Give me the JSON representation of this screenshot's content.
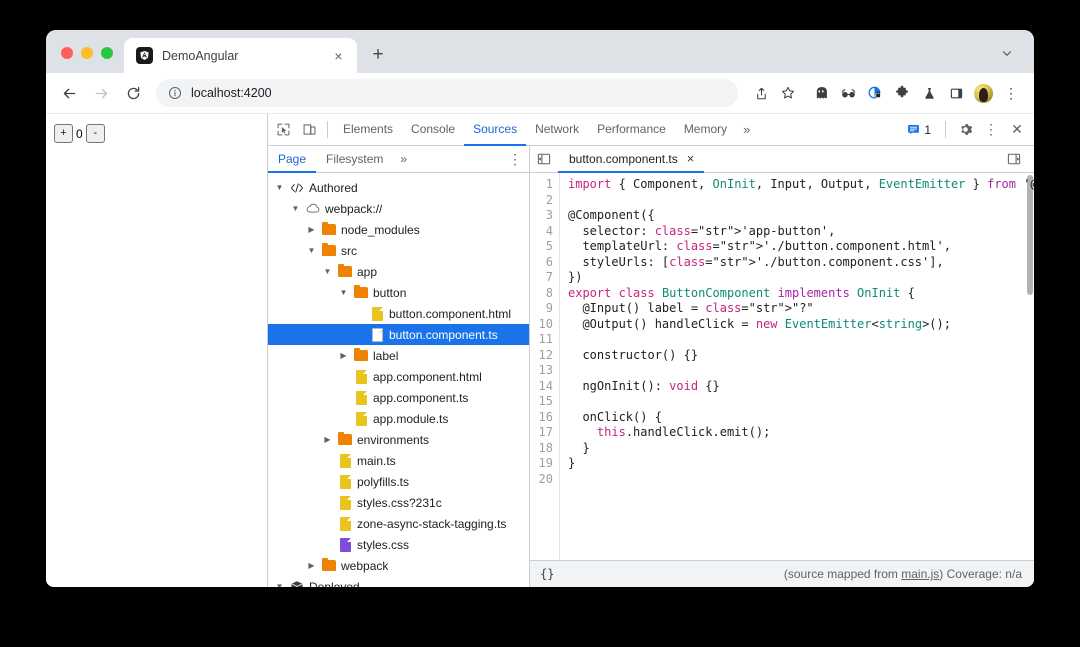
{
  "browser": {
    "tab": {
      "title": "DemoAngular",
      "favicon": "angular-logo",
      "close_label": "×"
    },
    "new_tab_label": "+",
    "nav": {
      "back": "←",
      "forward": "→",
      "reload": "↻"
    },
    "omnibox": {
      "url": "localhost:4200",
      "security_icon": "info-circle-icon"
    },
    "toolbar_icons": [
      "share-icon",
      "bookmark-star-icon",
      "ghost-icon",
      "glasses-icon",
      "privacy-shield-icon",
      "extensions-puzzle-icon",
      "lab-flask-icon",
      "side-panel-icon"
    ],
    "profile": "avatar",
    "menu_label": "⋮"
  },
  "viewport": {
    "zoom_plus": "+",
    "zoom_value": "0",
    "zoom_minus": "-"
  },
  "devtools": {
    "tabs": [
      {
        "label": "Elements",
        "active": false
      },
      {
        "label": "Console",
        "active": false
      },
      {
        "label": "Sources",
        "active": true
      },
      {
        "label": "Network",
        "active": false
      },
      {
        "label": "Performance",
        "active": false
      },
      {
        "label": "Memory",
        "active": false
      }
    ],
    "more_tabs": "»",
    "issues_count": "1",
    "inspect_icon": "inspect-element-icon",
    "device_icon": "device-toolbar-icon",
    "settings_icon": "gear-icon",
    "kebab_icon": "more-options-icon",
    "close_icon": "close-icon",
    "navigator": {
      "tabs": [
        {
          "label": "Page",
          "active": true
        },
        {
          "label": "Filesystem",
          "active": false
        }
      ],
      "more": "»",
      "kebab": "⋮",
      "tree": [
        {
          "indent": 0,
          "twisty": "down",
          "icon": "code-brackets",
          "label": "Authored",
          "selected": false
        },
        {
          "indent": 1,
          "twisty": "down",
          "icon": "cloud",
          "label": "webpack://",
          "selected": false
        },
        {
          "indent": 2,
          "twisty": "right",
          "icon": "folder",
          "label": "node_modules",
          "selected": false
        },
        {
          "indent": 2,
          "twisty": "down",
          "icon": "folder",
          "label": "src",
          "selected": false
        },
        {
          "indent": 3,
          "twisty": "down",
          "icon": "folder",
          "label": "app",
          "selected": false
        },
        {
          "indent": 4,
          "twisty": "down",
          "icon": "folder",
          "label": "button",
          "selected": false
        },
        {
          "indent": 5,
          "twisty": "none",
          "icon": "file-yellow",
          "label": "button.component.html",
          "selected": false
        },
        {
          "indent": 5,
          "twisty": "none",
          "icon": "file-white",
          "label": "button.component.ts",
          "selected": true
        },
        {
          "indent": 4,
          "twisty": "right",
          "icon": "folder",
          "label": "label",
          "selected": false
        },
        {
          "indent": 4,
          "twisty": "none",
          "icon": "file-yellow",
          "label": "app.component.html",
          "selected": false
        },
        {
          "indent": 4,
          "twisty": "none",
          "icon": "file-yellow",
          "label": "app.component.ts",
          "selected": false
        },
        {
          "indent": 4,
          "twisty": "none",
          "icon": "file-yellow",
          "label": "app.module.ts",
          "selected": false
        },
        {
          "indent": 3,
          "twisty": "right",
          "icon": "folder",
          "label": "environments",
          "selected": false
        },
        {
          "indent": 3,
          "twisty": "none",
          "icon": "file-yellow",
          "label": "main.ts",
          "selected": false
        },
        {
          "indent": 3,
          "twisty": "none",
          "icon": "file-yellow",
          "label": "polyfills.ts",
          "selected": false
        },
        {
          "indent": 3,
          "twisty": "none",
          "icon": "file-yellow",
          "label": "styles.css?231c",
          "selected": false
        },
        {
          "indent": 3,
          "twisty": "none",
          "icon": "file-yellow",
          "label": "zone-async-stack-tagging.ts",
          "selected": false
        },
        {
          "indent": 3,
          "twisty": "none",
          "icon": "file-purple",
          "label": "styles.css",
          "selected": false
        },
        {
          "indent": 2,
          "twisty": "right",
          "icon": "folder",
          "label": "webpack",
          "selected": false
        },
        {
          "indent": 0,
          "twisty": "down",
          "icon": "cube",
          "label": "Deployed",
          "selected": false
        }
      ]
    },
    "editor": {
      "sidebar_toggle_left": "show-navigator-icon",
      "sidebar_toggle_right": "show-debugger-icon",
      "tab": {
        "label": "button.component.ts",
        "close": "×"
      },
      "gutter": [
        "1",
        "2",
        "3",
        "4",
        "5",
        "6",
        "7",
        "8",
        "9",
        "10",
        "11",
        "12",
        "13",
        "14",
        "15",
        "16",
        "17",
        "18",
        "19",
        "20"
      ],
      "lines": [
        "import { Component, OnInit, Input, Output, EventEmitter } from '@a",
        "",
        "@Component({",
        "  selector: 'app-button',",
        "  templateUrl: './button.component.html',",
        "  styleUrls: ['./button.component.css'],",
        "})",
        "export class ButtonComponent implements OnInit {",
        "  @Input() label = \"?\"",
        "  @Output() handleClick = new EventEmitter<string>();",
        "",
        "  constructor() {}",
        "",
        "  ngOnInit(): void {}",
        "",
        "  onClick() {",
        "    this.handleClick.emit();",
        "  }",
        "}",
        ""
      ]
    },
    "status": {
      "pretty_print": "{}",
      "source_map_prefix": "(source mapped from ",
      "source_map_link": "main.js",
      "source_map_suffix": ") Coverage: n/a"
    }
  },
  "colors": {
    "accent_blue": "#1a73e8",
    "selection_blue": "#1a73e8",
    "folder_orange": "#ef8200",
    "file_yellow": "#e9c41f",
    "file_purple": "#7d4edb",
    "keyword_magenta": "#c5267f",
    "string_red": "#c41a16",
    "class_teal": "#0f8a74"
  }
}
